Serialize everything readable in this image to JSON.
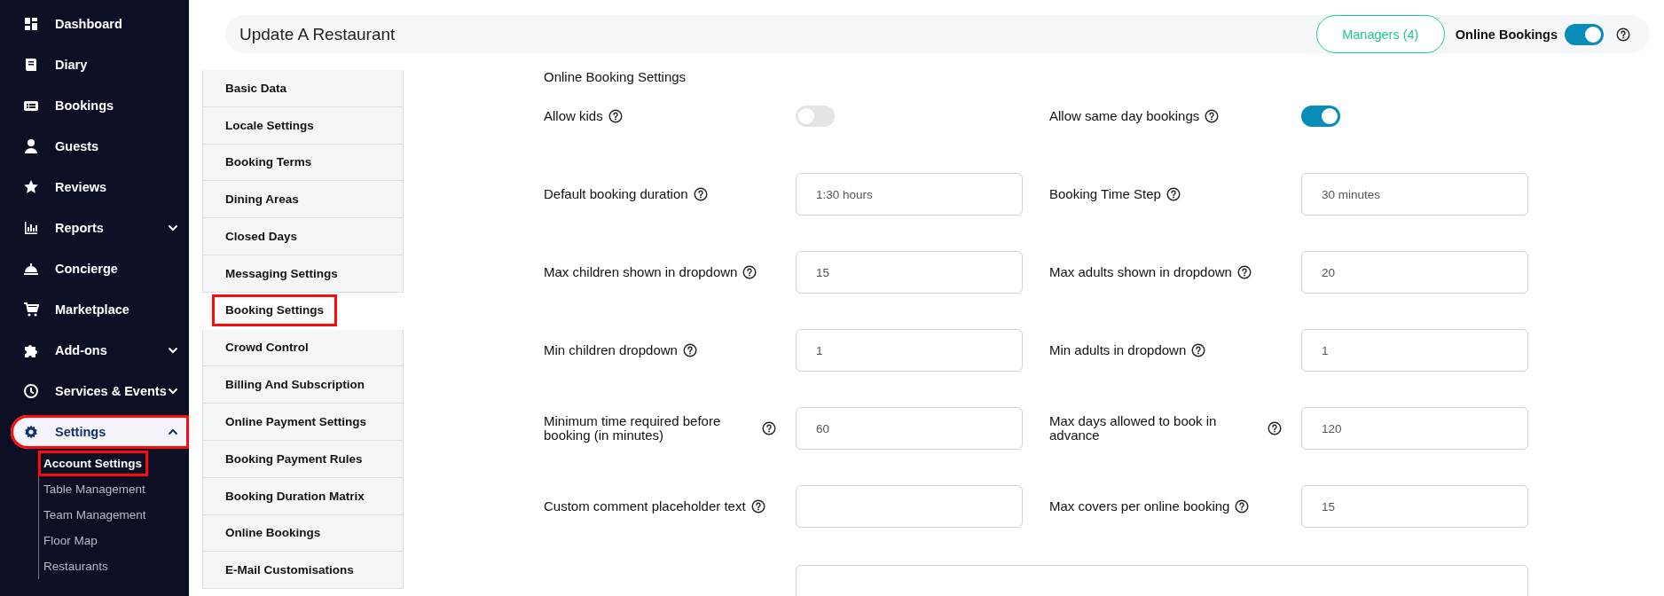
{
  "sidebar": {
    "items": [
      {
        "label": "Dashboard",
        "kind": "link",
        "selected": false,
        "highlighted": false
      },
      {
        "label": "Diary",
        "kind": "link",
        "selected": false,
        "highlighted": false
      },
      {
        "label": "Bookings",
        "kind": "link",
        "selected": false,
        "highlighted": false
      },
      {
        "label": "Guests",
        "kind": "link",
        "selected": false,
        "highlighted": false
      },
      {
        "label": "Reviews",
        "kind": "link",
        "selected": false,
        "highlighted": false
      },
      {
        "label": "Reports",
        "kind": "menu",
        "expanded": false,
        "selected": false,
        "highlighted": false
      },
      {
        "label": "Concierge",
        "kind": "link",
        "selected": false,
        "highlighted": false
      },
      {
        "label": "Marketplace",
        "kind": "link",
        "selected": false,
        "highlighted": false
      },
      {
        "label": "Add-ons",
        "kind": "menu",
        "expanded": false,
        "selected": false,
        "highlighted": false
      },
      {
        "label": "Services & Events",
        "kind": "menu",
        "expanded": false,
        "selected": false,
        "highlighted": false
      },
      {
        "label": "Settings",
        "kind": "menu",
        "expanded": true,
        "selected": true,
        "highlighted": true,
        "children": [
          {
            "label": "Account Settings",
            "selected": true,
            "highlighted": true
          },
          {
            "label": "Table Management",
            "selected": false,
            "highlighted": false
          },
          {
            "label": "Team Management",
            "selected": false,
            "highlighted": false
          },
          {
            "label": "Floor Map",
            "selected": false,
            "highlighted": false
          },
          {
            "label": "Restaurants",
            "selected": false,
            "highlighted": false
          }
        ]
      }
    ]
  },
  "header": {
    "title": "Update A Restaurant",
    "managers_button": "Managers (4)",
    "online_bookings": {
      "label": "Online Bookings",
      "on": true
    }
  },
  "tabs": [
    {
      "label": "Basic Data",
      "selected": false,
      "highlighted": false
    },
    {
      "label": "Locale Settings",
      "selected": false,
      "highlighted": false
    },
    {
      "label": "Booking Terms",
      "selected": false,
      "highlighted": false
    },
    {
      "label": "Dining Areas",
      "selected": false,
      "highlighted": false
    },
    {
      "label": "Closed Days",
      "selected": false,
      "highlighted": false
    },
    {
      "label": "Messaging Settings",
      "selected": false,
      "highlighted": false
    },
    {
      "label": "Booking Settings",
      "selected": true,
      "highlighted": true
    },
    {
      "label": "Crowd Control",
      "selected": false,
      "highlighted": false
    },
    {
      "label": "Billing And Subscription",
      "selected": false,
      "highlighted": false
    },
    {
      "label": "Online Payment Settings",
      "selected": false,
      "highlighted": false
    },
    {
      "label": "Booking Payment Rules",
      "selected": false,
      "highlighted": false
    },
    {
      "label": "Booking Duration Matrix",
      "selected": false,
      "highlighted": false
    },
    {
      "label": "Online Bookings",
      "selected": false,
      "highlighted": false
    },
    {
      "label": "E-Mail Customisations",
      "selected": false,
      "highlighted": false
    }
  ],
  "form": {
    "heading": "Online Booking Settings",
    "fields": [
      {
        "kind": "toggle",
        "label": "Allow kids",
        "on": false
      },
      {
        "kind": "toggle",
        "label": "Allow same day bookings",
        "on": true
      },
      {
        "kind": "input",
        "label": "Default booking duration",
        "value": "1:30 hours"
      },
      {
        "kind": "input",
        "label": "Booking Time Step",
        "value": "30 minutes"
      },
      {
        "kind": "input",
        "label": "Max children shown in dropdown",
        "value": "15"
      },
      {
        "kind": "input",
        "label": "Max adults shown in dropdown",
        "value": "20"
      },
      {
        "kind": "input",
        "label": "Min children dropdown",
        "value": "1"
      },
      {
        "kind": "input",
        "label": "Min adults in dropdown",
        "value": "1"
      },
      {
        "kind": "input",
        "label": "Minimum time required before booking (in minutes)",
        "value": "60"
      },
      {
        "kind": "input",
        "label": "Max days allowed to book in advance",
        "value": "120"
      },
      {
        "kind": "input",
        "label": "Custom comment placeholder text"
      },
      {
        "kind": "input",
        "label": "Max covers per online booking",
        "value": "15"
      },
      {
        "kind": "wide-input"
      }
    ]
  }
}
